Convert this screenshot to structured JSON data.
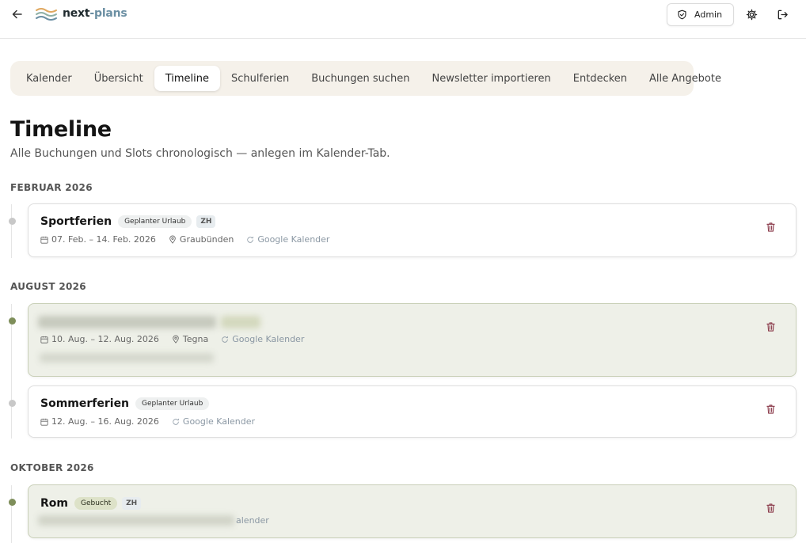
{
  "header": {
    "brand_part1": "next",
    "brand_part2": "-plans",
    "admin_label": "Admin"
  },
  "tabs": [
    {
      "label": "Kalender"
    },
    {
      "label": "Übersicht"
    },
    {
      "label": "Timeline",
      "active": true
    },
    {
      "label": "Schulferien"
    },
    {
      "label": "Buchungen suchen"
    },
    {
      "label": "Newsletter importieren"
    },
    {
      "label": "Entdecken"
    },
    {
      "label": "Alle Angebote"
    }
  ],
  "page": {
    "title": "Timeline",
    "subtitle": "Alle Buchungen und Slots chronologisch — anlegen im Kalender-Tab."
  },
  "months": [
    {
      "label": "FEBRUAR 2026"
    },
    {
      "label": "AUGUST 2026"
    },
    {
      "label": "OKTOBER 2026"
    }
  ],
  "entries": [
    {
      "title": "Sportferien",
      "badge": "Geplanter Urlaub",
      "tag": "ZH",
      "dates": "07. Feb. – 14. Feb. 2026",
      "location": "Graubünden",
      "source": "Google Kalender"
    },
    {
      "title": "",
      "dates": "10. Aug. – 12. Aug. 2026",
      "location": "Tegna",
      "source": "Google Kalender"
    },
    {
      "title": "Sommerferien",
      "badge": "Geplanter Urlaub",
      "dates": "12. Aug. – 16. Aug. 2026",
      "source": "Google Kalender"
    },
    {
      "title": "Rom",
      "badge": "Gebucht",
      "tag": "ZH",
      "source_partial": "alender"
    }
  ],
  "colors": {
    "accent_green": "#7e8e5a",
    "booked_bg": "#eef0e8",
    "tabs_bg": "#f5f1ea",
    "trash": "#8a3a4a"
  }
}
